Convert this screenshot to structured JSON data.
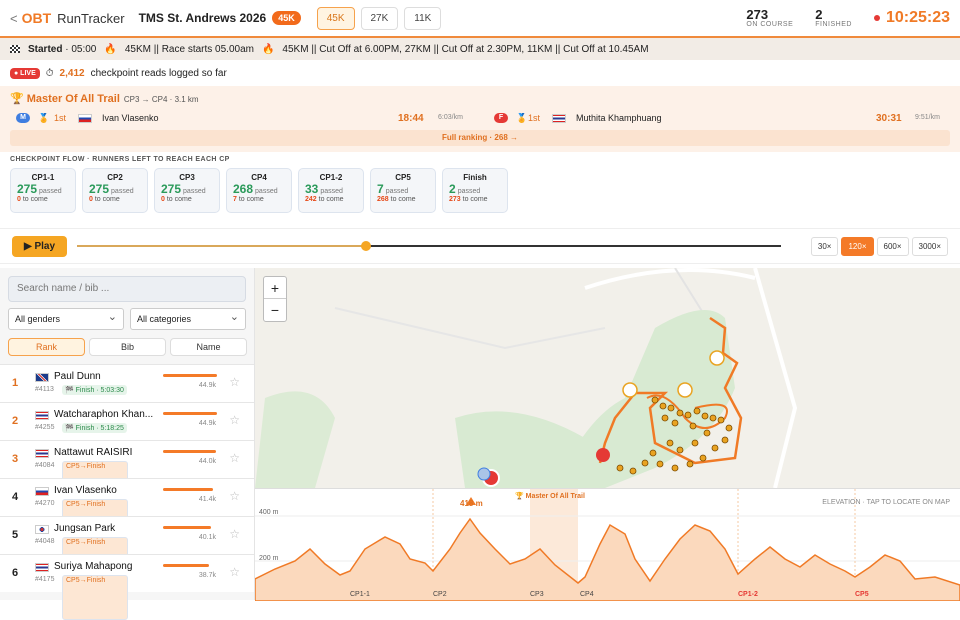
{
  "header": {
    "back": "<",
    "logo_o": "O",
    "logo_bt": "BT",
    "app": "RunTracker",
    "event": "TMS St. Andrews 2026",
    "event_badge": "45K",
    "distances": [
      "45K",
      "27K",
      "11K"
    ],
    "active_distance": "45K",
    "on_course": "273",
    "on_course_label": "ON COURSE",
    "finished": "2",
    "finished_label": "FINISHED",
    "clock": "10:25:23"
  },
  "ticker": {
    "started": "Started",
    "started_time": "· 05:00",
    "msg1": "45KM || Race starts 05.00am",
    "msg2": "45KM || Cut Off at 6.00PM, 27KM || Cut Off at 2.30PM, 11KM || Cut Off at 10.45AM"
  },
  "live": {
    "badge": "● LIVE",
    "count": "2,412",
    "text": "checkpoint reads logged so far"
  },
  "master": {
    "title": "Master Of All Trail",
    "segment": "CP3 → CP4 · 3.1 km",
    "male": {
      "g": "M",
      "pos": "1st",
      "name": "Ivan Vlasenko",
      "time": "18:44",
      "pace": "6:03/km"
    },
    "female": {
      "g": "F",
      "pos": "1st",
      "name": "Muthita Khamphuang",
      "time": "30:31",
      "pace": "9:51/km"
    },
    "full_ranking": "Full ranking · 268 →"
  },
  "checkpoints": {
    "title": "CHECKPOINT FLOW · RUNNERS LEFT TO REACH EACH CP",
    "passed_label": "passed",
    "come_label": "to come",
    "items": [
      {
        "name": "CP1-1",
        "passed": "275",
        "come": "0"
      },
      {
        "name": "CP2",
        "passed": "275",
        "come": "0"
      },
      {
        "name": "CP3",
        "passed": "275",
        "come": "0"
      },
      {
        "name": "CP4",
        "passed": "268",
        "come": "7"
      },
      {
        "name": "CP1-2",
        "passed": "33",
        "come": "242"
      },
      {
        "name": "CP5",
        "passed": "7",
        "come": "268"
      },
      {
        "name": "Finish",
        "passed": "2",
        "come": "273"
      }
    ]
  },
  "playback": {
    "play": "▶ Play",
    "progress": 0.41,
    "speeds": [
      "30×",
      "120×",
      "600×",
      "3000×"
    ],
    "active_speed": "120×"
  },
  "filters": {
    "search_placeholder": "Search  name / bib ...",
    "gender": "All genders",
    "category": "All categories",
    "sort": [
      "Rank",
      "Bib",
      "Name"
    ],
    "active_sort": "Rank"
  },
  "runners": [
    {
      "rank": "1",
      "name": "Paul Dunn",
      "bib": "#4113",
      "tag": "🏁 Finish · 5:03:30",
      "tagtype": "fin",
      "dist": "44.9k",
      "flag": "gb",
      "frac": 0.998
    },
    {
      "rank": "2",
      "name": "Watcharaphon Khan...",
      "bib": "#4255",
      "tag": "🏁 Finish · 5:18:25",
      "tagtype": "fin",
      "dist": "44.9k",
      "flag": "th",
      "frac": 0.998
    },
    {
      "rank": "3",
      "name": "Nattawut RAISIRI",
      "bib": "#4084",
      "tag": "CP5→Finish",
      "tagtype": "cp",
      "dist": "44.0k",
      "flag": "th",
      "frac": 0.98
    },
    {
      "rank": "4",
      "name": "Ivan Vlasenko",
      "bib": "#4270",
      "tag": "CP5→Finish",
      "tagtype": "cp",
      "dist": "41.4k",
      "flag": "ru",
      "frac": 0.92
    },
    {
      "rank": "5",
      "name": "Jungsan Park",
      "bib": "#4048",
      "tag": "CP5→Finish",
      "tagtype": "cp",
      "dist": "40.1k",
      "flag": "kr",
      "frac": 0.89
    },
    {
      "rank": "6",
      "name": "Suriya Mahapong",
      "bib": "#4175",
      "tag": "CP5→Finish",
      "tagtype": "cp",
      "dist": "38.7k",
      "flag": "th",
      "frac": 0.86
    }
  ],
  "map": {
    "zoom_in": "+",
    "zoom_out": "−"
  },
  "elevation": {
    "hint": "ELEVATION · TAP TO LOCATE ON MAP",
    "y400": "400 m",
    "y200": "200 m",
    "peak": "418 m",
    "master": "Master Of All Trail",
    "cps": [
      "CP1-1",
      "CP2",
      "CP3",
      "CP4",
      "CP1-2",
      "CP5"
    ]
  },
  "colors": {
    "accent": "#f07a26",
    "passed": "#2a9a5a",
    "come": "#e64a19"
  }
}
